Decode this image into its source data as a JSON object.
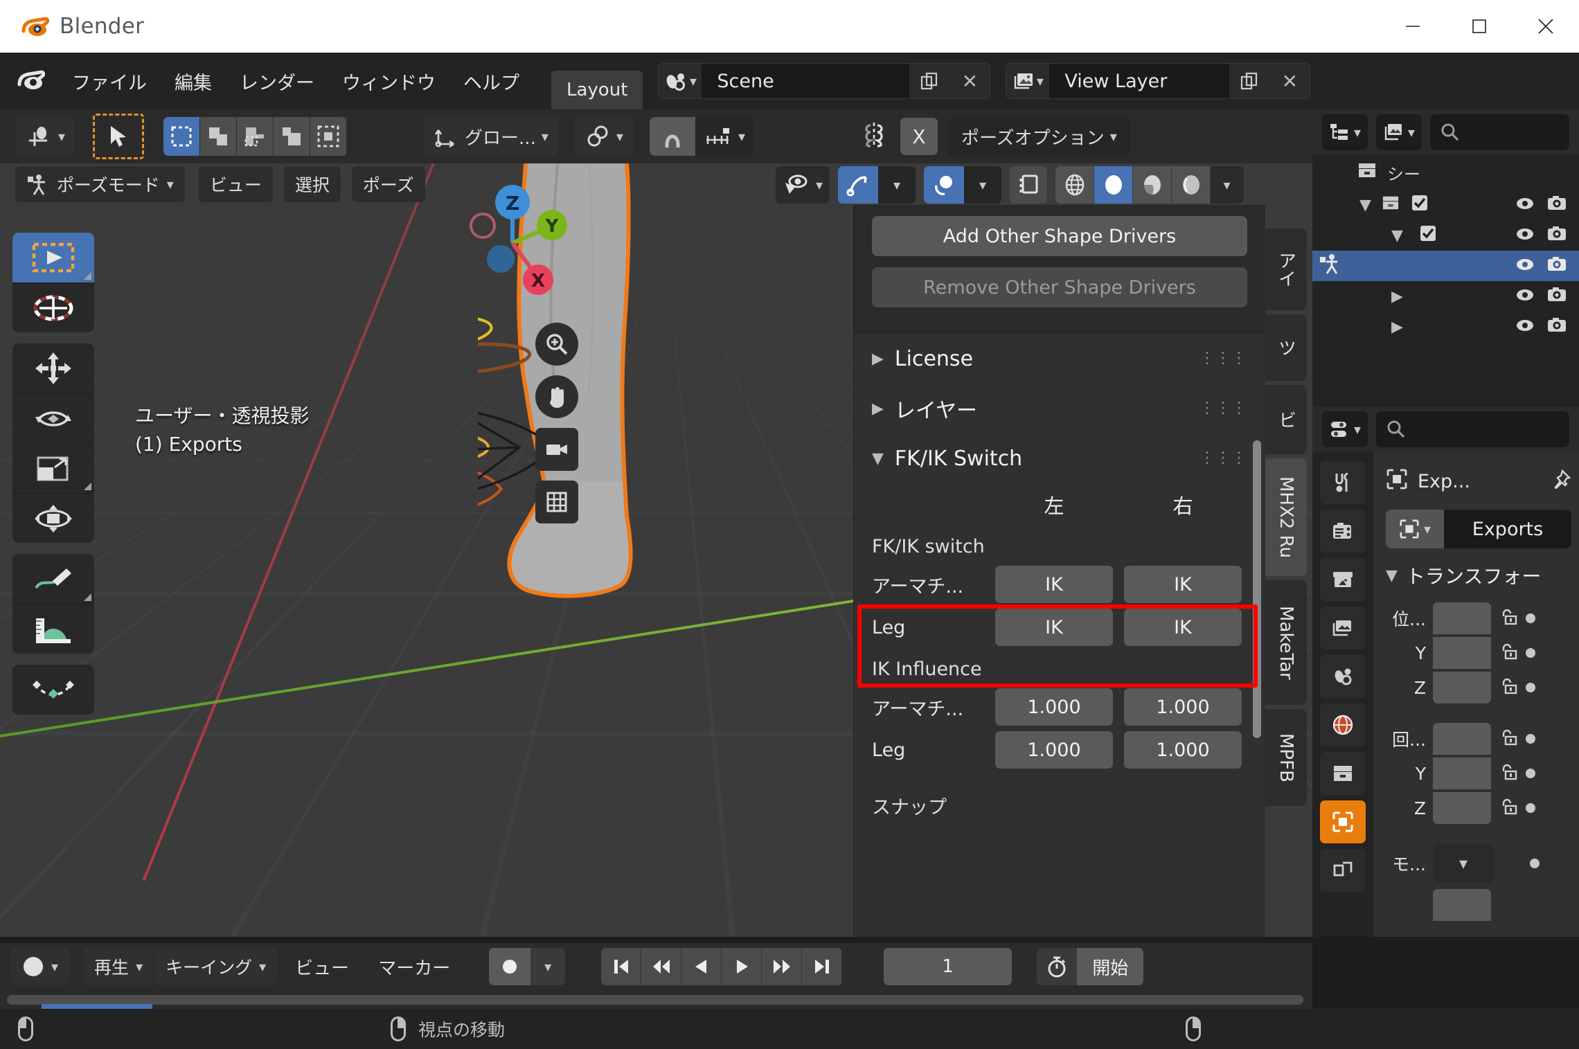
{
  "window": {
    "app_title": "Blender",
    "minimize_label": "Minimize",
    "maximize_label": "Maximize",
    "close_label": "Close"
  },
  "topbar": {
    "menus": [
      "ファイル",
      "編集",
      "レンダー",
      "ウィンドウ",
      "ヘルプ"
    ],
    "workspace_tab": "Layout",
    "scene_name": "Scene",
    "view_layer_name": "View Layer"
  },
  "tool_header": {
    "transform_orientation": "グロー...",
    "pose_options": "ポーズオプション",
    "mirror_x": "X"
  },
  "viewport_header": {
    "mode": "ポーズモード",
    "menus": [
      "ビュー",
      "選択",
      "ポーズ"
    ]
  },
  "viewport": {
    "view_label": "ユーザー・透視投影",
    "collection_label": "(1) Exports",
    "gizmo_axes": [
      "Z",
      "Y",
      "X"
    ]
  },
  "npanel": {
    "add_shape_drivers": "Add Other Shape Drivers",
    "remove_shape_drivers": "Remove Other Shape Drivers",
    "sections": [
      {
        "label": "License",
        "open": false
      },
      {
        "label": "レイヤー",
        "open": false
      },
      {
        "label": "FK/IK Switch",
        "open": true
      }
    ],
    "columns": [
      "左",
      "右"
    ],
    "fkik_caption": "FK/IK switch",
    "fkik_rows": [
      {
        "label": "アーマチ...",
        "left": "IK",
        "right": "IK"
      },
      {
        "label": "Leg",
        "left": "IK",
        "right": "IK"
      }
    ],
    "influence_caption": "IK Influence",
    "influence_rows": [
      {
        "label": "アーマチ...",
        "left": "1.000",
        "right": "1.000"
      },
      {
        "label": "Leg",
        "left": "1.000",
        "right": "1.000"
      }
    ],
    "snap_caption": "スナップ",
    "highlight_color": "#fe0000"
  },
  "vtabs": [
    {
      "label": "アイ",
      "active": false
    },
    {
      "label": "ツ",
      "active": false
    },
    {
      "label": "ビ",
      "active": false
    },
    {
      "label": "MHX2 Ru",
      "active": true
    },
    {
      "label": "MakeTar",
      "active": false
    },
    {
      "label": "MPFB",
      "active": false
    }
  ],
  "outliner": {
    "scene_label": "シー",
    "rows": [
      {
        "indent": 0,
        "tri": "down",
        "icon": "collection-icon",
        "label": "",
        "checkbox": true,
        "eye": true,
        "camera": true,
        "selected": false
      },
      {
        "indent": 1,
        "tri": "down",
        "icon": "",
        "label": "",
        "checkbox": true,
        "eye": true,
        "camera": true,
        "selected": false
      },
      {
        "indent": 2,
        "tri": "",
        "icon": "armature-icon",
        "label": "",
        "checkbox": false,
        "eye": true,
        "camera": true,
        "selected": true
      },
      {
        "indent": 2,
        "tri": "right",
        "icon": "",
        "label": "",
        "checkbox": false,
        "eye": true,
        "camera": true,
        "selected": false
      },
      {
        "indent": 2,
        "tri": "right",
        "icon": "",
        "label": "",
        "checkbox": false,
        "eye": true,
        "camera": true,
        "selected": false
      }
    ]
  },
  "properties": {
    "breadcrumb": "Exp...",
    "object_name": "Exports",
    "transform_title": "トランスフォー",
    "location": {
      "label": "位...",
      "axes": [
        "Y",
        "Z"
      ]
    },
    "rotation": {
      "label": "回...",
      "axes": [
        "Y",
        "Z"
      ]
    },
    "mode": {
      "label": "モ..."
    }
  },
  "timeline": {
    "menus": [
      "ビュー",
      "マーカー"
    ],
    "playback_label": "再生",
    "keying_label": "キーイング",
    "frame_current": "1",
    "start_label": "開始",
    "playback_buttons": [
      "jump-start",
      "prev-keyframe",
      "play-reverse",
      "play-forward",
      "next-keyframe",
      "jump-end"
    ]
  },
  "statusbar": {
    "hint_text": "視点の移動"
  },
  "colors": {
    "blender_orange": "#e8902a",
    "accent_blue": "#4772b3",
    "panel_bg": "#303030",
    "viewport_bg": "#3b3b3b",
    "highlight_red": "#fe0000",
    "outliner_select": "#3f6199"
  }
}
